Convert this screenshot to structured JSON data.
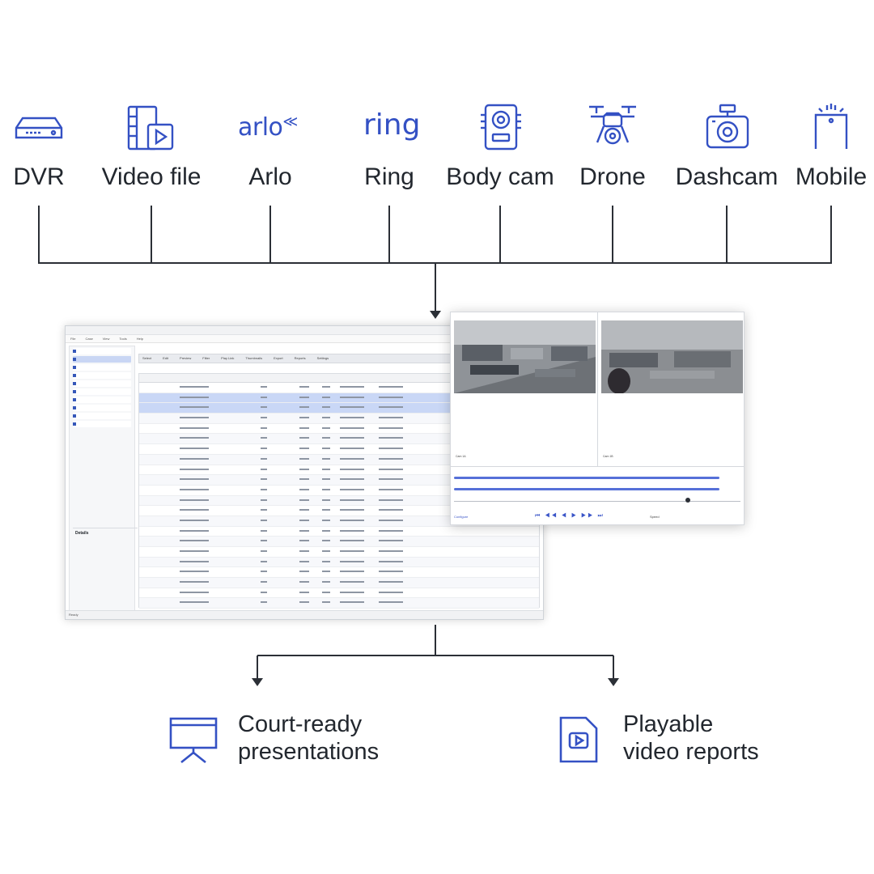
{
  "sources": [
    {
      "label": "DVR",
      "icon": "dvr-icon"
    },
    {
      "label": "Video file",
      "icon": "video-file-icon"
    },
    {
      "label": "Arlo",
      "icon": "arlo-logo"
    },
    {
      "label": "Ring",
      "icon": "ring-logo"
    },
    {
      "label": "Body cam",
      "icon": "body-cam-icon"
    },
    {
      "label": "Drone",
      "icon": "drone-icon"
    },
    {
      "label": "Dashcam",
      "icon": "dashcam-icon"
    },
    {
      "label": "Mobile",
      "icon": "mobile-icon"
    }
  ],
  "logos": {
    "arlo": "arlo",
    "ring": "ring"
  },
  "outputs": [
    {
      "line1": "Court-ready",
      "line2": "presentations",
      "icon": "presentation-board-icon"
    },
    {
      "line1": "Playable",
      "line2": "video reports",
      "icon": "video-report-icon"
    }
  ],
  "app_screenshot": {
    "menu": [
      "File",
      "Case",
      "View",
      "Tools",
      "Help"
    ],
    "toolbar": [
      "Select",
      "Edit",
      "Preview",
      "Filter",
      "Play Link",
      "Thumbnails",
      "Export",
      "Reports",
      "Settings"
    ],
    "details_heading": "Details",
    "status_left": "Ready"
  },
  "player": {
    "camera_labels": [
      "Cam 1A",
      "Cam 1B"
    ],
    "speed_label": "Speed",
    "configure_label": "Configure"
  },
  "colors": {
    "accent": "#3451c4",
    "line": "#2b2f36",
    "text": "#22272e"
  }
}
